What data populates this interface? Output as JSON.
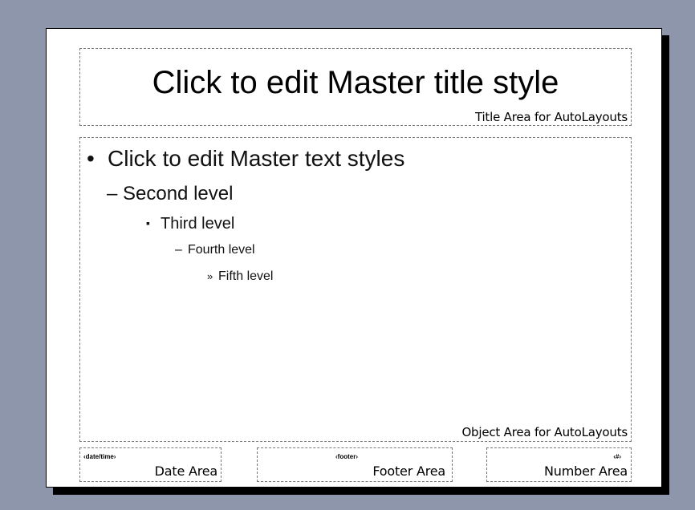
{
  "master": {
    "title": {
      "text": "Click to edit Master title style",
      "caption": "Title Area for AutoLayouts"
    },
    "body": {
      "levels": [
        {
          "marker": "•",
          "text": "Click to edit Master text styles"
        },
        {
          "marker": "–",
          "text": "Second level"
        },
        {
          "marker": "▪",
          "text": "Third level"
        },
        {
          "marker": "–",
          "text": "Fourth level"
        },
        {
          "marker": "»",
          "text": "Fifth level"
        }
      ],
      "caption": "Object Area for AutoLayouts"
    },
    "date": {
      "token": "‹date/time›",
      "caption": "Date Area"
    },
    "footer": {
      "token": "‹footer›",
      "caption": "Footer Area"
    },
    "number": {
      "token": "‹#›",
      "caption": "Number Area"
    }
  },
  "colors": {
    "workspace": "#8d96aa",
    "slide": "#ffffff",
    "shadow": "#000000",
    "placeholder_border": "#7a7a7a"
  },
  "icons": {
    "cursor": "i-beam-cursor-icon"
  }
}
